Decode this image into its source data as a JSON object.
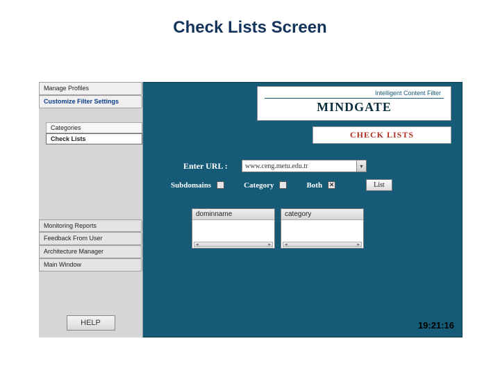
{
  "slide": {
    "title": "Check Lists Screen"
  },
  "sidebar": {
    "manage_profiles": "Manage Profiles",
    "customize_filter": "Customize Filter Settings",
    "categories": "Categories",
    "check_lists": "Check Lists",
    "monitoring_reports": "Monitoring Reports",
    "feedback": "Feedback From User",
    "arch_manager": "Architecture Manager",
    "main_window": "Main Window",
    "help_label": "HELP"
  },
  "brand": {
    "tagline": "Intelligent Content Filter",
    "name": "MINDGATE"
  },
  "screen": {
    "title": "CHECK LISTS"
  },
  "form": {
    "url_label": "Enter URL :",
    "url_value": "www.ceng.metu.edu.tr",
    "subdomains_label": "Subdomains",
    "category_label": "Category",
    "both_label": "Both",
    "subdomains_checked": false,
    "category_checked": false,
    "both_checked": true,
    "list_button": "List"
  },
  "results": {
    "col1": "dominname",
    "col2": "category"
  },
  "status": {
    "time": "19:21:16"
  }
}
